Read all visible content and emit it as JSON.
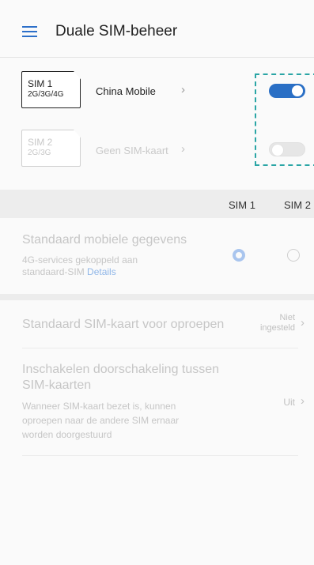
{
  "header": {
    "title": "Duale SIM-beheer",
    "menu_icon": "hamburger-menu-icon"
  },
  "sims": [
    {
      "card_line1": "SIM 1",
      "card_line2": "2G/3G/4G",
      "name": "China Mobile",
      "enabled": true
    },
    {
      "card_line1": "SIM 2",
      "card_line2": "2G/3G",
      "name": "Geen SIM-kaart",
      "enabled": false
    }
  ],
  "columns": {
    "sim1": "SIM 1",
    "sim2": "SIM 2"
  },
  "mobile_data": {
    "title": "Standaard mobiele gegevens",
    "subtitle_line1": "4G-services gekoppeld aan",
    "subtitle_line2": "standaard-SIM",
    "details_link": "Details"
  },
  "calls": {
    "title": "Standaard SIM-kaart voor oproepen",
    "value_line1": "Niet",
    "value_line2": "ingesteld"
  },
  "forwarding": {
    "title_line1": "Inschakelen doorschakeling tussen",
    "title_line2": "SIM-kaarten",
    "desc_line1": "Wanneer SIM-kaart bezet is, kunnen",
    "desc_line2": "oproepen naar de andere SIM ernaar",
    "desc_line3": "worden doorgestuurd",
    "value": "Uit"
  },
  "colors": {
    "accent": "#2a6fc5",
    "highlight": "#2aa5a5"
  }
}
